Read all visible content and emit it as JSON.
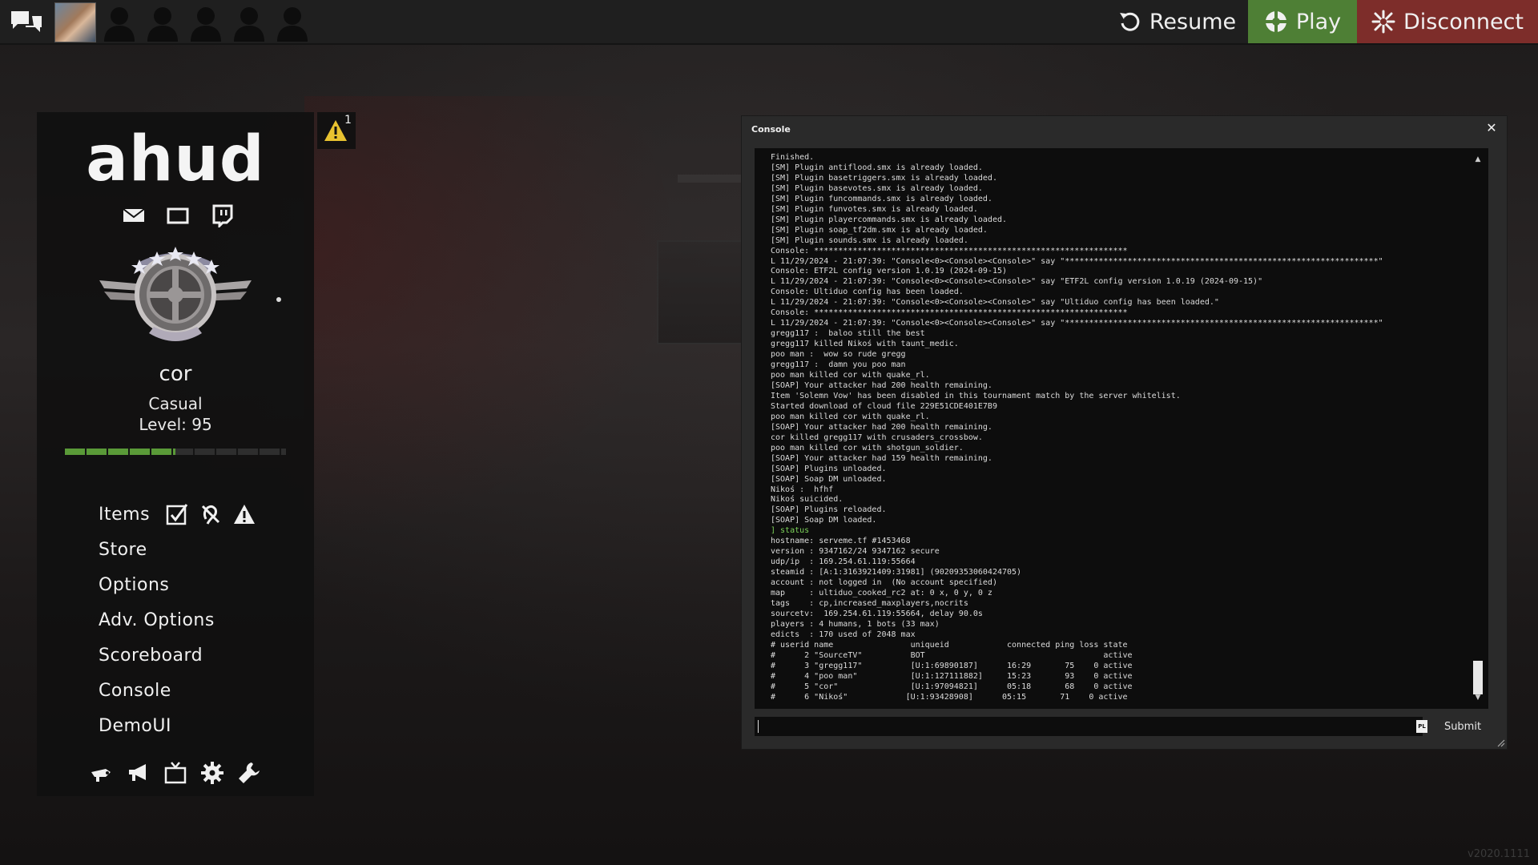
{
  "topbar": {
    "resume_label": "Resume",
    "play_label": "Play",
    "disconnect_label": "Disconnect",
    "colors": {
      "play": "#4e7f35",
      "disconnect": "#7d2d2a",
      "bar": "#1f1f1f"
    }
  },
  "panel": {
    "title": "ahud",
    "player_name": "cor",
    "mode": "Casual",
    "level": "Level: 95",
    "level_progress_fraction": 0.5,
    "menu": [
      {
        "label": "Items"
      },
      {
        "label": "Store"
      },
      {
        "label": "Options"
      },
      {
        "label": "Adv. Options"
      },
      {
        "label": "Scoreboard"
      },
      {
        "label": "Console"
      },
      {
        "label": "DemoUI"
      }
    ]
  },
  "warning_badge": {
    "count": "1"
  },
  "console": {
    "title": "Console",
    "close_glyph": "✕",
    "submit_label": "Submit",
    "lang_badge": "PL",
    "input_value": "",
    "lines": [
      "Finished.",
      "[SM] Plugin antiflood.smx is already loaded.",
      "[SM] Plugin basetriggers.smx is already loaded.",
      "[SM] Plugin basevotes.smx is already loaded.",
      "[SM] Plugin funcommands.smx is already loaded.",
      "[SM] Plugin funvotes.smx is already loaded.",
      "[SM] Plugin playercommands.smx is already loaded.",
      "[SM] Plugin soap_tf2dm.smx is already loaded.",
      "[SM] Plugin sounds.smx is already loaded.",
      "Console: *****************************************************************",
      "L 11/29/2024 - 21:07:39: \"Console<0><Console><Console>\" say \"*****************************************************************\"",
      "Console: ETF2L config version 1.0.19 (2024-09-15)",
      "L 11/29/2024 - 21:07:39: \"Console<0><Console><Console>\" say \"ETF2L config version 1.0.19 (2024-09-15)\"",
      "Console: Ultiduo config has been loaded.",
      "L 11/29/2024 - 21:07:39: \"Console<0><Console><Console>\" say \"Ultiduo config has been loaded.\"",
      "Console: *****************************************************************",
      "L 11/29/2024 - 21:07:39: \"Console<0><Console><Console>\" say \"*****************************************************************\"",
      "gregg117 :  baloo still the best",
      "gregg117 killed Nikoś with taunt_medic.",
      "poo man :  wow so rude gregg",
      "gregg117 :  damn you poo man",
      "poo man killed cor with quake_rl.",
      "[SOAP] Your attacker had 200 health remaining.",
      "Item 'Solemn Vow' has been disabled in this tournament match by the server whitelist.",
      "Started download of cloud file 229E51CDE401E7B9",
      "poo man killed cor with quake_rl.",
      "[SOAP] Your attacker had 200 health remaining.",
      "cor killed gregg117 with crusaders_crossbow.",
      "poo man killed cor with shotgun_soldier.",
      "[SOAP] Your attacker had 159 health remaining.",
      "[SOAP] Plugins unloaded.",
      "[SOAP] Soap DM unloaded.",
      "Nikoś :  hfhf",
      "Nikoś suicided.",
      "[SOAP] Plugins reloaded.",
      "[SOAP] Soap DM loaded.",
      "] status",
      "hostname: serveme.tf #1453468",
      "version : 9347162/24 9347162 secure",
      "udp/ip  : 169.254.61.119:55664",
      "steamid : [A:1:3163921409:31981] (90209353060424705)",
      "account : not logged in  (No account specified)",
      "map     : ultiduo_cooked_rc2 at: 0 x, 0 y, 0 z",
      "tags    : cp,increased_maxplayers,nocrits",
      "sourcetv:  169.254.61.119:55664, delay 90.0s",
      "players : 4 humans, 1 bots (33 max)",
      "edicts  : 170 used of 2048 max",
      "# userid name                uniqueid            connected ping loss state",
      "#      2 \"SourceTV\"          BOT                                     active",
      "#      3 \"gregg117\"          [U:1:69890187]      16:29       75    0 active",
      "#      4 \"poo man\"           [U:1:127111882]     15:23       93    0 active",
      "#      5 \"cor\"               [U:1:97094821]      05:18       68    0 active",
      "#      6 \"Nikoś\"            [U:1:93428908]      05:15       71    0 active"
    ],
    "command_line_index": 36
  },
  "version_tag": "v2020.1111"
}
